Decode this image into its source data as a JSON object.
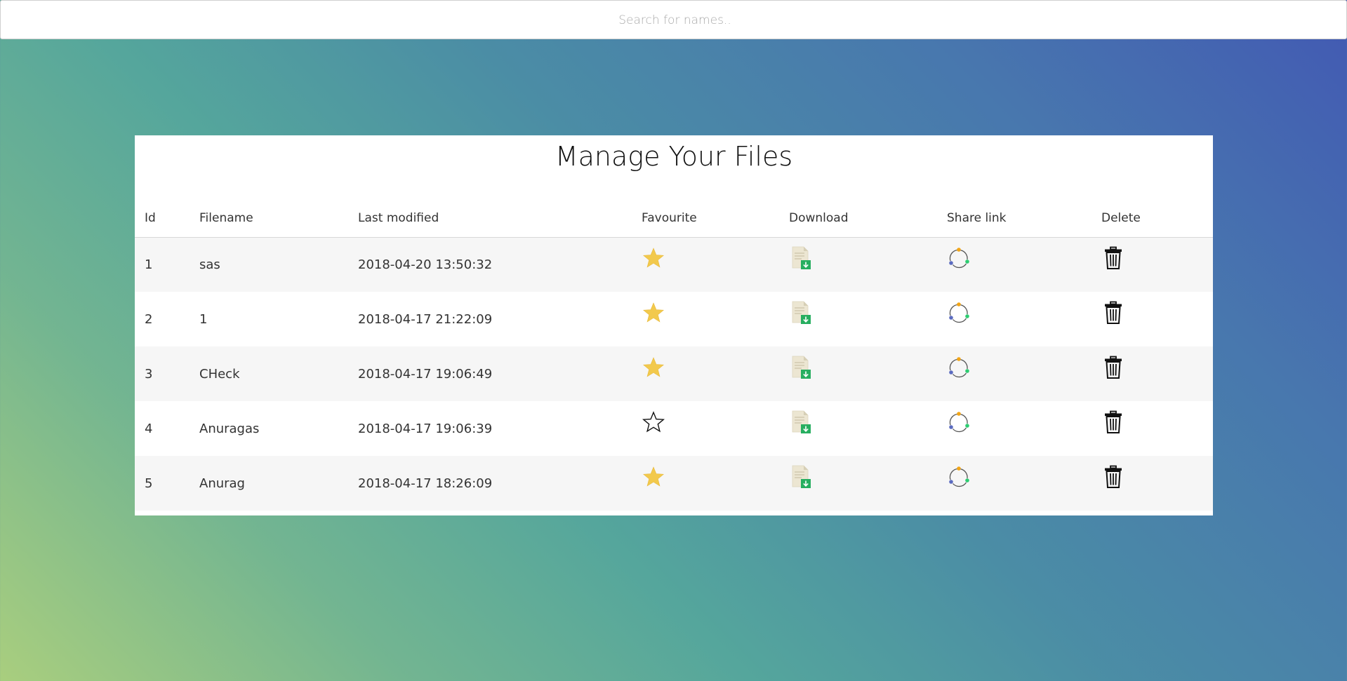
{
  "search": {
    "placeholder": "Search for names.."
  },
  "panel": {
    "title": "Manage Your Files"
  },
  "table": {
    "headers": {
      "id": "Id",
      "filename": "Filename",
      "modified": "Last modified",
      "favourite": "Favourite",
      "download": "Download",
      "share": "Share link",
      "delete": "Delete"
    },
    "rows": [
      {
        "id": "1",
        "filename": "sas",
        "modified": "2018-04-20 13:50:32",
        "favourite": true
      },
      {
        "id": "2",
        "filename": "1",
        "modified": "2018-04-17 21:22:09",
        "favourite": true
      },
      {
        "id": "3",
        "filename": "CHeck",
        "modified": "2018-04-17 19:06:49",
        "favourite": true
      },
      {
        "id": "4",
        "filename": "Anuragas",
        "modified": "2018-04-17 19:06:39",
        "favourite": false
      },
      {
        "id": "5",
        "filename": "Anurag",
        "modified": "2018-04-17 18:26:09",
        "favourite": true
      }
    ]
  },
  "icons": {
    "favourite_on": "star-filled-icon",
    "favourite_off": "star-outline-icon",
    "download": "file-download-icon",
    "share": "share-link-icon",
    "delete": "trash-icon"
  },
  "colors": {
    "star": "#f2c94c",
    "download_arrow": "#27ae60",
    "share_orange": "#f2a516",
    "share_green": "#2ecc71",
    "share_blue": "#5b6bc0"
  }
}
